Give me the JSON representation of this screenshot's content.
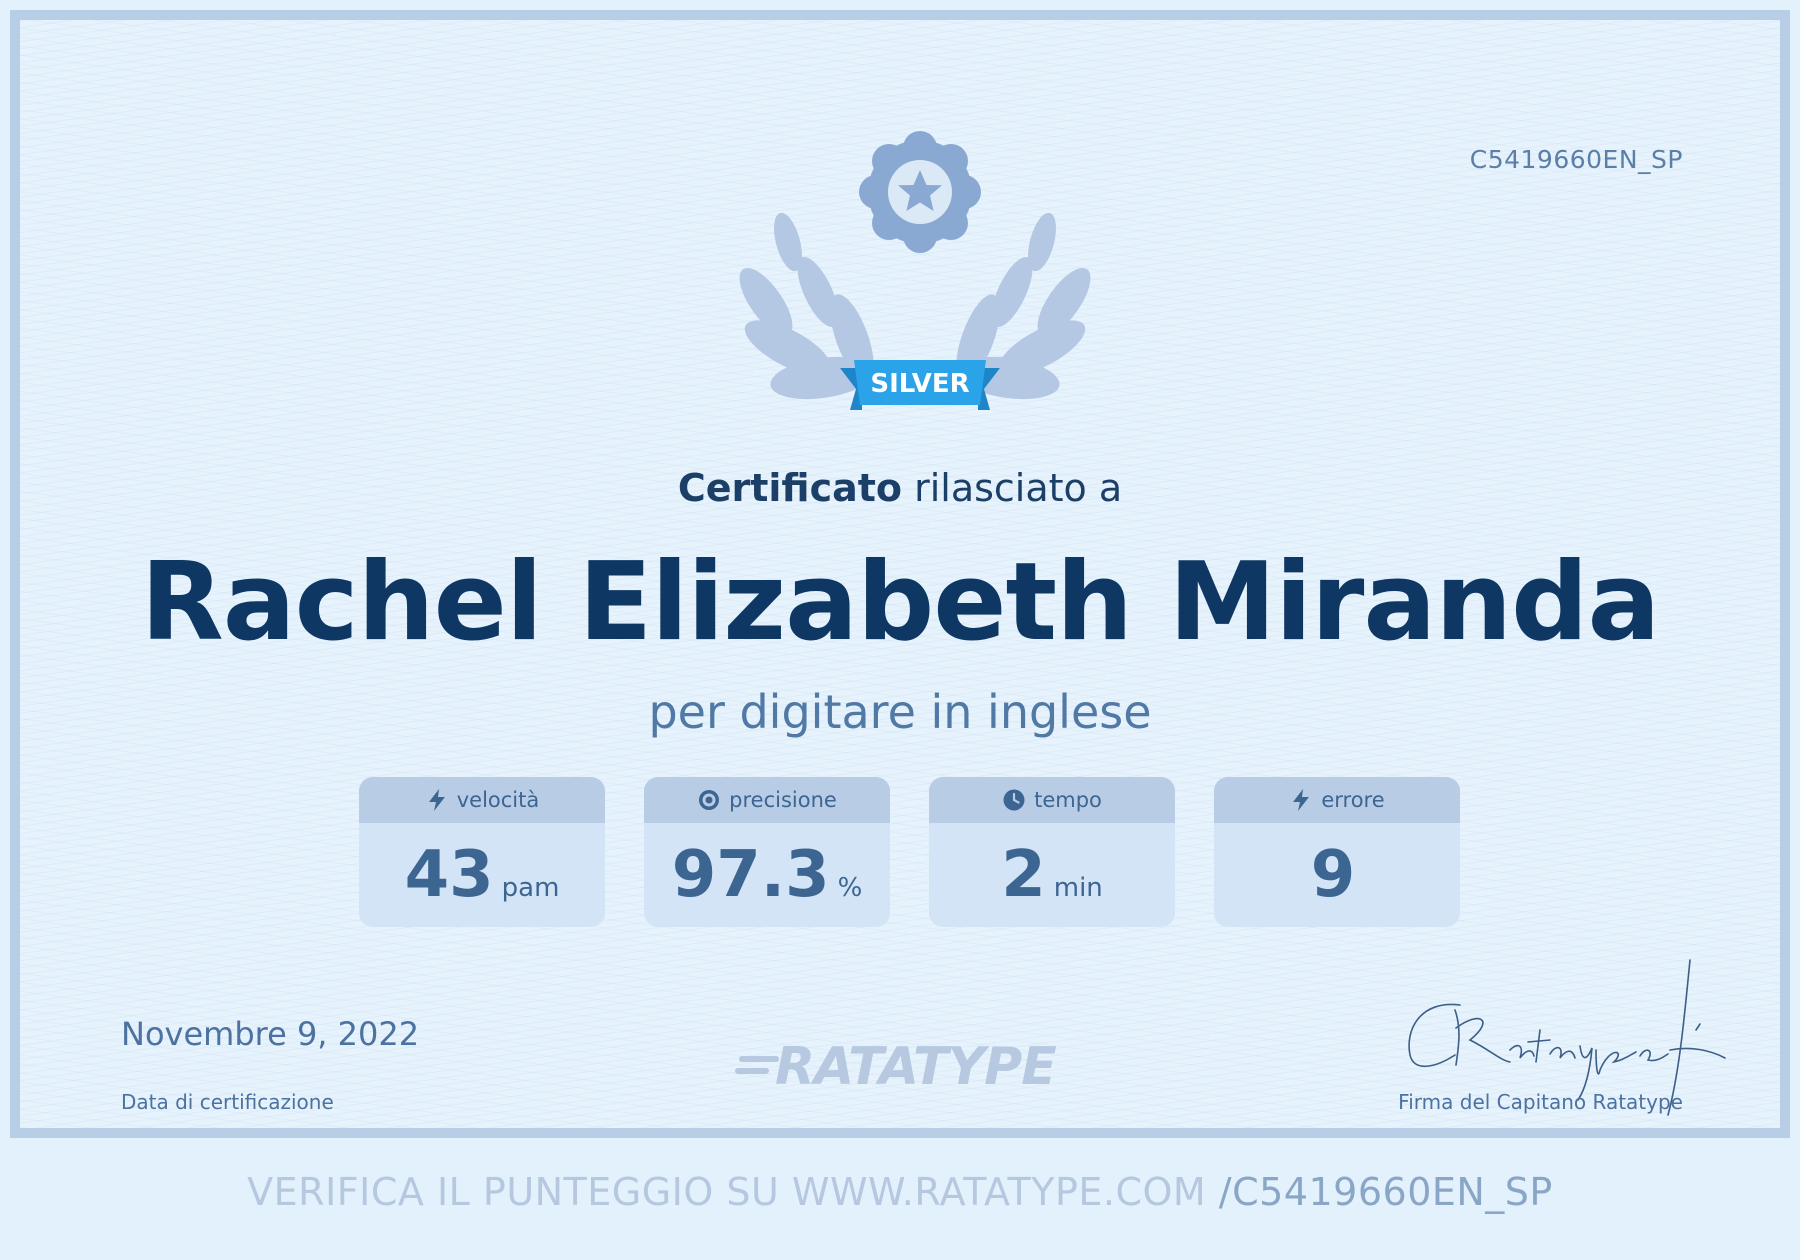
{
  "certificate": {
    "code": "C5419660EN_SP",
    "level": "SILVER",
    "issued_bold": "Certificato",
    "issued_rest": " rilasciato a",
    "recipient": "Rachel Elizabeth Miranda",
    "subject": "per digitare in inglese"
  },
  "stats": [
    {
      "label": "velocità",
      "icon": "lightning-icon",
      "value": "43",
      "unit": "pam"
    },
    {
      "label": "precisione",
      "icon": "target-icon",
      "value": "97.3",
      "unit": "%"
    },
    {
      "label": "tempo",
      "icon": "clock-icon",
      "value": "2",
      "unit": "min"
    },
    {
      "label": "errore",
      "icon": "lightning-icon",
      "value": "9",
      "unit": ""
    }
  ],
  "footer": {
    "date": "Novembre 9, 2022",
    "date_label": "Data di certificazione",
    "brand": "RATATYPE",
    "signature_label": "Firma del Capitano Ratatype"
  },
  "verify": {
    "text": "VERIFICA IL PUNTEGGIO SU WWW.RATATYPE.COM",
    "code": "/C5419660EN_SP"
  },
  "colors": {
    "ribbon": "#2ba3e8",
    "badge": "#89a9d2",
    "laurel": "#b4c8e3",
    "name": "#0f3764"
  }
}
